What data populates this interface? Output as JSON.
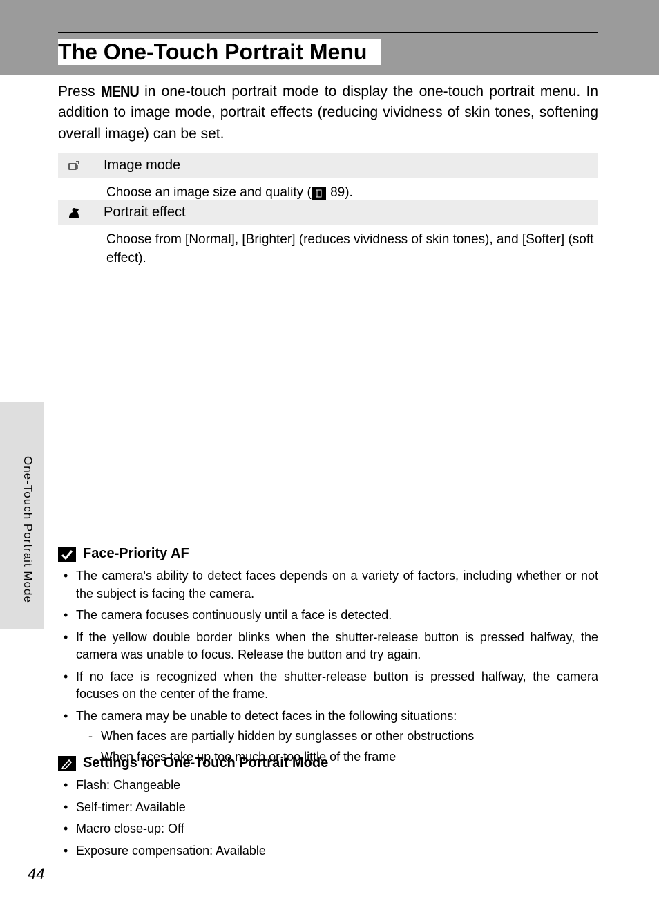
{
  "sidebar_label": "One-Touch Portrait Mode",
  "title": "The One-Touch Portrait Menu",
  "intro_pre": "Press ",
  "intro_glyph": "MENU",
  "intro_post": " in one-touch portrait mode to display the one-touch portrait menu. In addition to image mode, portrait effects (reducing vividness of skin tones, softening overall image) can be set.",
  "sections": [
    {
      "heading": "Image mode",
      "body_pre": "Choose an image size and quality (",
      "ref": "89",
      "body_post": ")."
    },
    {
      "heading": "Portrait effect",
      "body": "Choose from [Normal], [Brighter] (reduces vividness of skin tones), and [Softer] (soft effect)."
    }
  ],
  "note1": {
    "title": "Face-Priority AF",
    "bullets": [
      "The camera's ability to detect faces depends on a variety of factors, including whether or not the subject is facing the camera.",
      "The camera focuses continuously until a face is detected.",
      "If the yellow double border blinks when the shutter-release button is pressed halfway, the camera was unable to focus. Release the button and try again.",
      "If no face is recognized when the shutter-release button is pressed halfway, the camera focuses on the center of the frame.",
      "The camera may be unable to detect faces in the following situations:"
    ],
    "sub": [
      "When faces are partially hidden by sunglasses or other obstructions",
      "When faces take up too much or too little of the frame"
    ]
  },
  "note2": {
    "title": "Settings for One-Touch Portrait Mode",
    "bullets": [
      "Flash: Changeable",
      "Self-timer: Available",
      "Macro close-up: Off",
      "Exposure compensation: Available"
    ]
  },
  "page_number": "44"
}
